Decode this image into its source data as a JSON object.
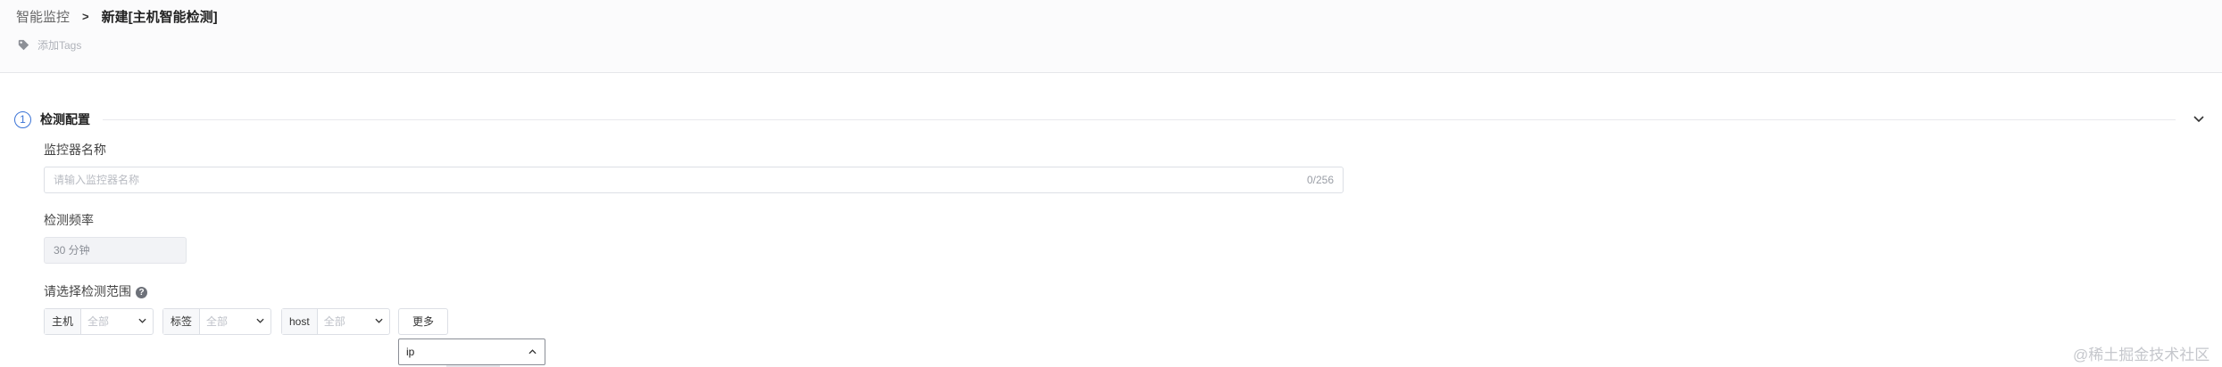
{
  "breadcrumb": {
    "parent": "智能监控",
    "separator": ">",
    "current": "新建[主机智能检测]"
  },
  "tags": {
    "icon": "tag-icon",
    "label": "添加Tags"
  },
  "section": {
    "step": "1",
    "title": "检测配置",
    "collapse_icon": "chevron-down-icon"
  },
  "monitor_name": {
    "label": "监控器名称",
    "placeholder": "请输入监控器名称",
    "value": "",
    "counter": "0/256"
  },
  "frequency": {
    "label": "检测频率",
    "value": "30 分钟"
  },
  "scope": {
    "label": "请选择检测范围",
    "help_icon": "question-circle-icon",
    "filters": [
      {
        "label": "主机",
        "value": "全部"
      },
      {
        "label": "标签",
        "value": "全部"
      },
      {
        "label": "host",
        "value": "全部"
      }
    ],
    "more_button": "更多",
    "dropdown": {
      "value": "ip",
      "icon": "chevron-up-icon"
    }
  },
  "watermark": "@稀土掘金技术社区",
  "colors": {
    "accent": "#3a73d6",
    "border": "#dcdfe5",
    "header_bg": "#fbfbfc"
  }
}
